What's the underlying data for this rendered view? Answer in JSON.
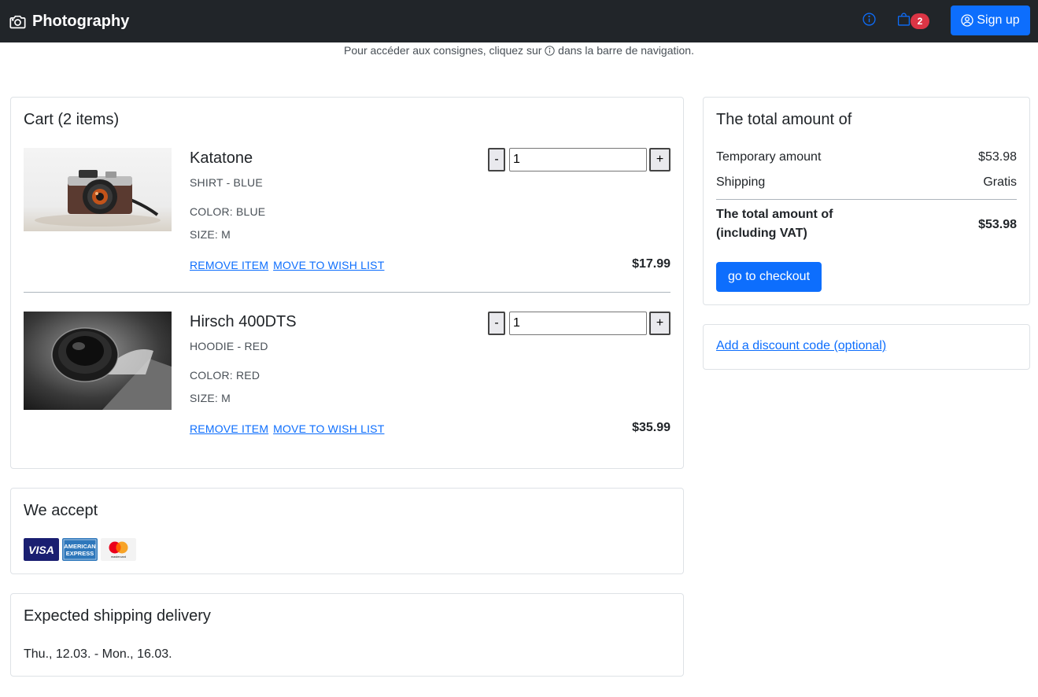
{
  "navbar": {
    "brand": "Photography",
    "info_icon": "info-circle-icon",
    "cart_icon": "shopping-bag-icon",
    "cart_count": "2",
    "signup_label": "Sign up",
    "colors": {
      "background": "#212529",
      "primary": "#0d6efd",
      "badge": "#dc3545"
    }
  },
  "notice": {
    "before": "Pour accéder aux consignes, cliquez sur",
    "after": "dans la barre de navigation."
  },
  "cart": {
    "title": "Cart (2 items)",
    "items": [
      {
        "name": "Katatone",
        "variant": "SHIRT - BLUE",
        "color": "COLOR: BLUE",
        "size": "SIZE: M",
        "quantity": "1",
        "minus": "-",
        "plus": "+",
        "remove": "REMOVE ITEM",
        "wishlist": "MOVE TO WISH LIST",
        "price": "$17.99"
      },
      {
        "name": "Hirsch 400DTS",
        "variant": "HOODIE - RED",
        "color": "COLOR: RED",
        "size": "SIZE: M",
        "quantity": "1",
        "minus": "-",
        "plus": "+",
        "remove": "REMOVE ITEM",
        "wishlist": "MOVE TO WISH LIST",
        "price": "$35.99"
      }
    ]
  },
  "accept": {
    "title": "We accept",
    "logos": [
      "visa-logo",
      "american-express-logo",
      "mastercard-logo"
    ],
    "visa_text": "VISA",
    "amex_line1": "AMERICAN",
    "amex_line2": "EXPRESS",
    "mastercard_text": "mastercard"
  },
  "shipping": {
    "title": "Expected shipping delivery",
    "dates": "Thu., 12.03. - Mon., 16.03."
  },
  "summary": {
    "title": "The total amount of",
    "temporary_label": "Temporary amount",
    "temporary_value": "$53.98",
    "shipping_label": "Shipping",
    "shipping_value": "Gratis",
    "total_label_line1": "The total amount of",
    "total_label_line2": "(including VAT)",
    "total_value": "$53.98",
    "checkout_label": "go to checkout"
  },
  "discount": {
    "link": "Add a discount code (optional)"
  }
}
